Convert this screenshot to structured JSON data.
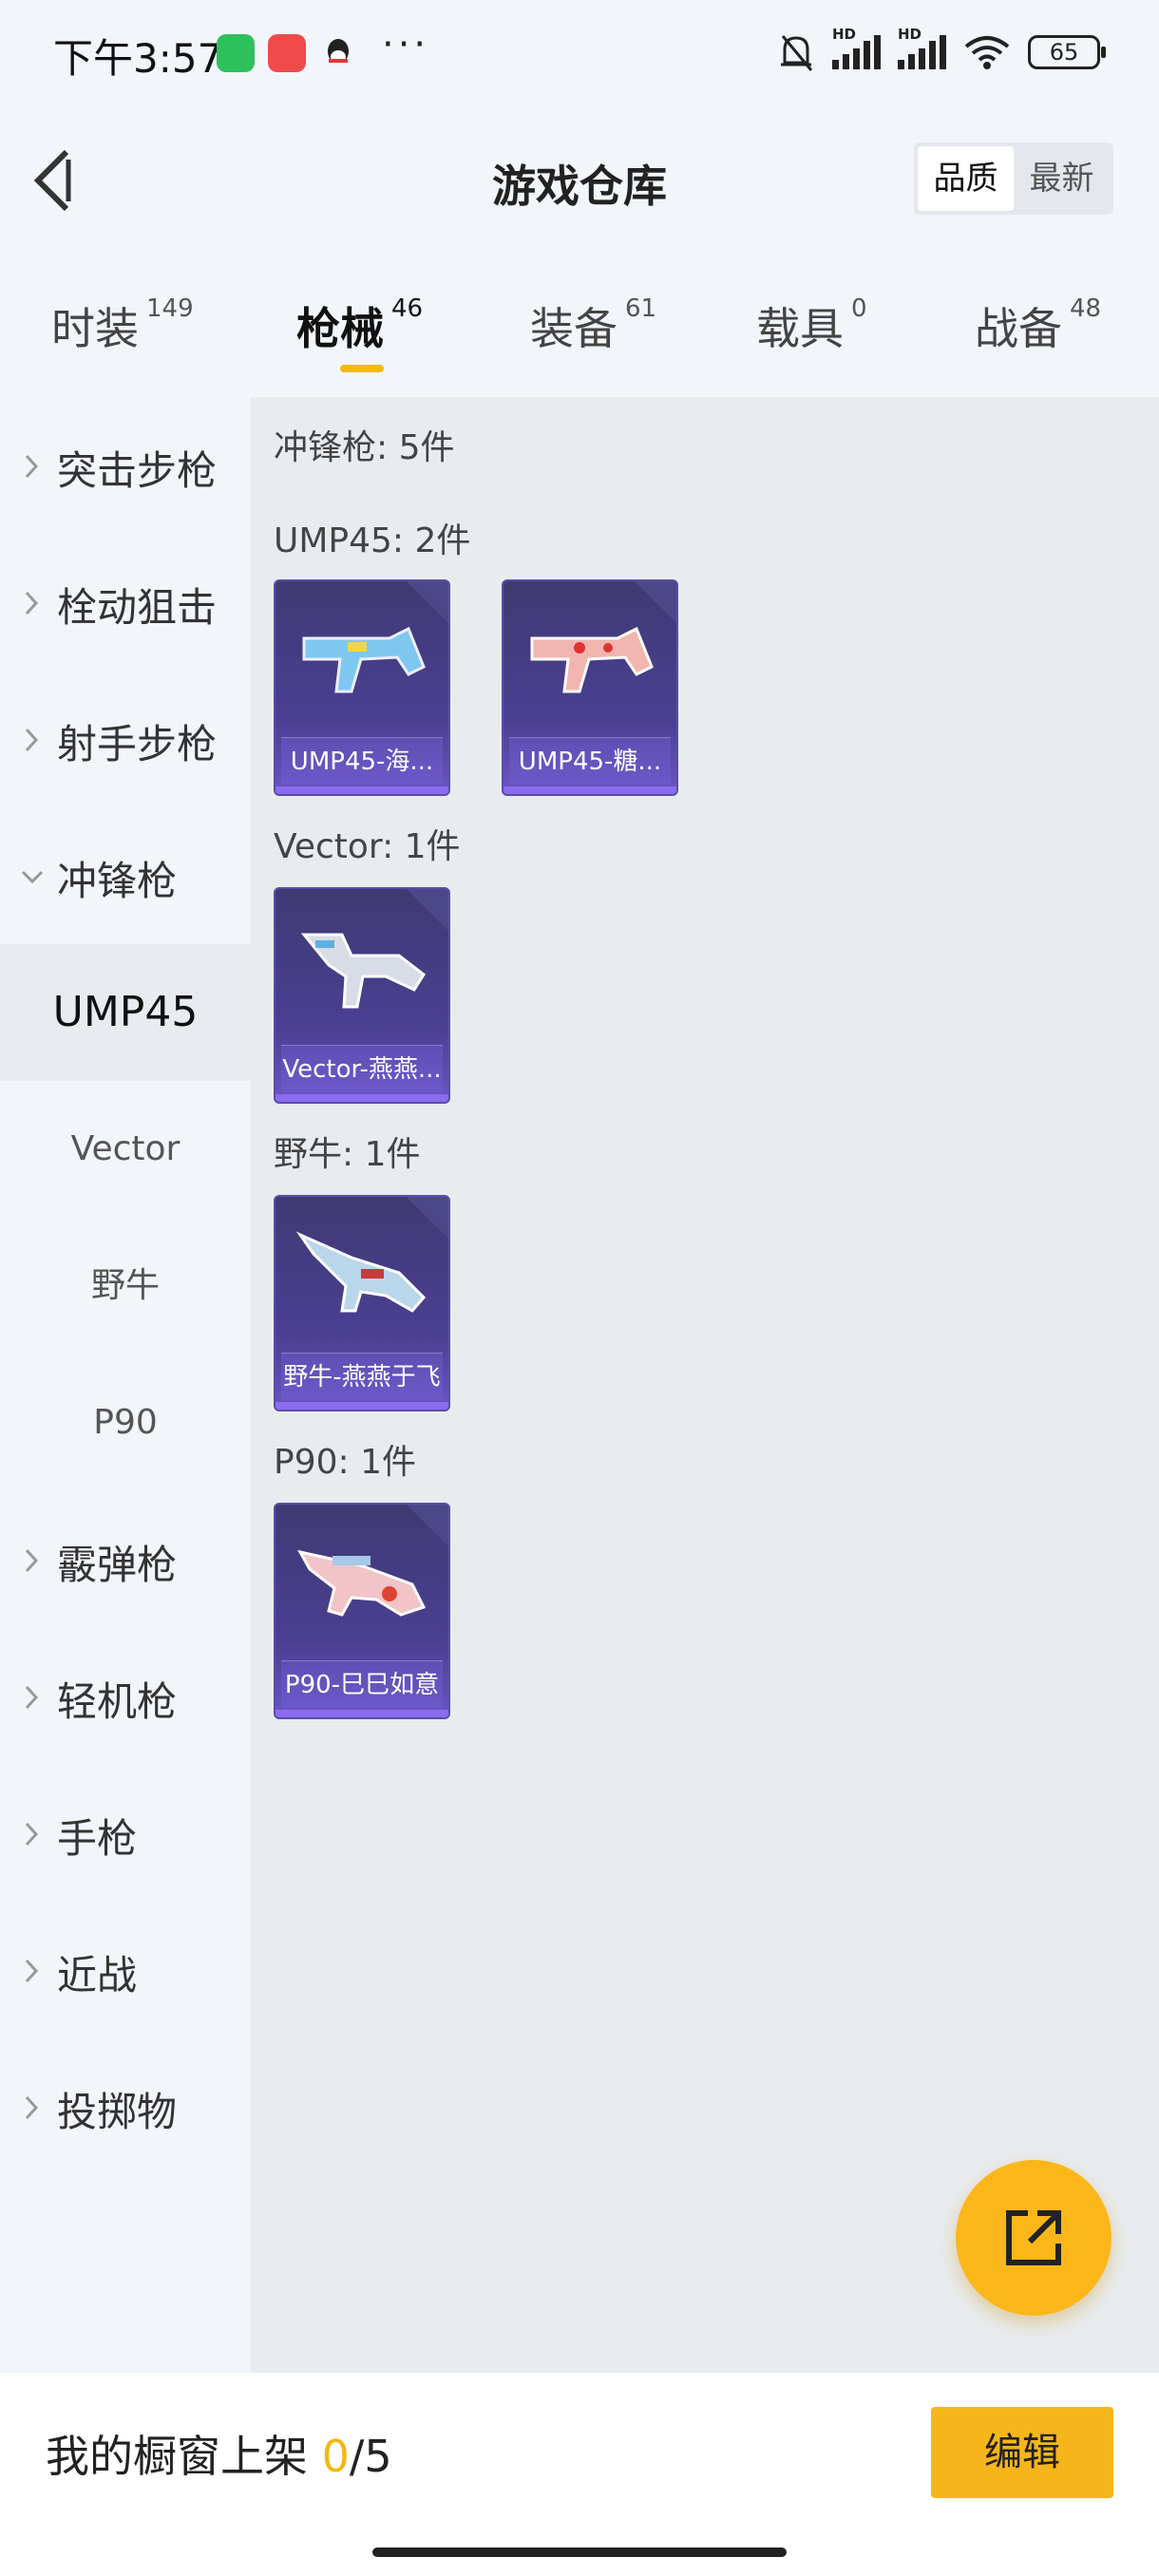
{
  "status": {
    "time": "下午3:57",
    "battery": "65",
    "signal_label": "HD"
  },
  "header": {
    "title": "游戏仓库",
    "sort_quality": "品质",
    "sort_latest": "最新"
  },
  "tabs": [
    {
      "label": "时装",
      "count": "149"
    },
    {
      "label": "枪械",
      "count": "46"
    },
    {
      "label": "装备",
      "count": "61"
    },
    {
      "label": "载具",
      "count": "0"
    },
    {
      "label": "战备",
      "count": "48"
    }
  ],
  "sidebar": {
    "categories": [
      "突击步枪",
      "栓动狙击",
      "射手步枪",
      "冲锋枪"
    ],
    "subs": [
      "UMP45",
      "Vector",
      "野牛",
      "P90"
    ],
    "more": [
      "霰弹枪",
      "轻机枪",
      "手枪",
      "近战",
      "投掷物"
    ]
  },
  "content": {
    "section_header": "冲锋枪: 5件",
    "groups": [
      {
        "title": "UMP45: 2件",
        "items": [
          "UMP45-海...",
          "UMP45-糖..."
        ]
      },
      {
        "title": "Vector: 1件",
        "items": [
          "Vector-燕燕..."
        ]
      },
      {
        "title": "野牛: 1件",
        "items": [
          "野牛-燕燕于飞"
        ]
      },
      {
        "title": "P90: 1件",
        "items": [
          "P90-巳巳如意"
        ]
      }
    ]
  },
  "bottom": {
    "label": "我的橱窗上架 ",
    "count": "0",
    "total": "/5",
    "edit": "编辑"
  },
  "colors": {
    "accent": "#f6b51a",
    "card": "#4b3f92"
  },
  "icons": [
    "back-arrow-icon",
    "chevron-right-icon",
    "chevron-down-icon",
    "share-icon",
    "wifi-icon",
    "bell-off-icon"
  ]
}
